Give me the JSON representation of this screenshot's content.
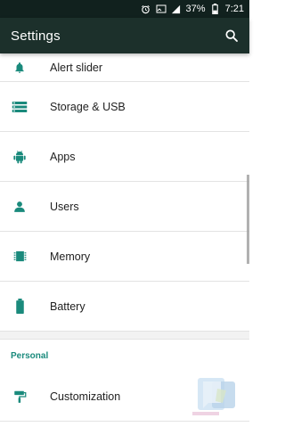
{
  "status_bar": {
    "battery": "37%",
    "time": "7:21",
    "icons": [
      "alarm-icon",
      "screen-cast-icon",
      "signal-icon",
      "battery-icon"
    ]
  },
  "app_bar": {
    "title": "Settings",
    "search_icon": "search-icon"
  },
  "items_top": [
    {
      "label": "Alert slider",
      "icon": "alert-slider-icon"
    },
    {
      "label": "Storage & USB",
      "icon": "storage-icon"
    },
    {
      "label": "Apps",
      "icon": "android-icon"
    },
    {
      "label": "Users",
      "icon": "person-icon"
    },
    {
      "label": "Memory",
      "icon": "memory-chip-icon"
    },
    {
      "label": "Battery",
      "icon": "battery-icon"
    }
  ],
  "section": {
    "header": "Personal"
  },
  "items_personal": [
    {
      "label": "Customization",
      "icon": "paint-roller-icon"
    }
  ],
  "colors": {
    "status_bar": "#11211e",
    "app_bar": "#1c302b",
    "accent": "#1a8a7c",
    "icon": "#1a8a7c",
    "text": "#212121"
  }
}
